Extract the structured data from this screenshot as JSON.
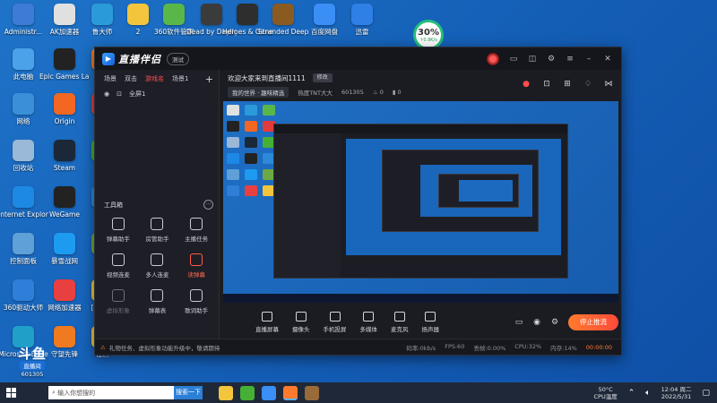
{
  "desktop": {
    "icons": [
      {
        "label": "Administr...",
        "color": "#3d7bd6"
      },
      {
        "label": "AK加速器",
        "color": "#e0e0e0"
      },
      {
        "label": "鲁大师",
        "color": "#2a9bd8"
      },
      {
        "label": "2",
        "color": "#f2c53d"
      },
      {
        "label": "360软件管家",
        "color": "#59b74a"
      },
      {
        "label": "Dead by Daylight",
        "color": "#3b3b3b"
      },
      {
        "label": "Heroes & Generals",
        "color": "#2e2e2e"
      },
      {
        "label": "Stranded Deep",
        "color": "#8a5a20"
      },
      {
        "label": "百度网盘",
        "color": "#3a8ef6"
      },
      {
        "label": "迅雷",
        "color": "#2e7fe6"
      },
      {
        "label": "此电脑",
        "color": "#4aa3e8"
      },
      {
        "label": "Epic Games Launcher",
        "color": "#222222"
      },
      {
        "label": "守望",
        "color": "#f07a20"
      },
      {
        "label": "网络",
        "color": "#3a8fd8"
      },
      {
        "label": "Origin",
        "color": "#f26722"
      },
      {
        "label": "腾讯",
        "color": "#e23b3b"
      },
      {
        "label": "回收站",
        "color": "#9ab8d8"
      },
      {
        "label": "Steam",
        "color": "#1b2838"
      },
      {
        "label": "微",
        "color": "#45b035"
      },
      {
        "label": "Internet Explorer",
        "color": "#1e88e5"
      },
      {
        "label": "WeGame",
        "color": "#222222"
      },
      {
        "label": "腾",
        "color": "#2c8ad8"
      },
      {
        "label": "控制面板",
        "color": "#5fa0d8"
      },
      {
        "label": "暴雪战网",
        "color": "#1d9bf0"
      },
      {
        "label": "我的",
        "color": "#6ca845"
      },
      {
        "label": "360驱动大师",
        "color": "#2f7fd8"
      },
      {
        "label": "网络加速器",
        "color": "#e84040"
      },
      {
        "label": "[2021-",
        "color": "#f2c53d"
      },
      {
        "label": "Microsoft Edge",
        "color": "#1fa0c8"
      },
      {
        "label": "守望先锋",
        "color": "#f07a20"
      },
      {
        "label": "社区",
        "color": "#f2c53d"
      }
    ],
    "net_widget": {
      "percent": "30%",
      "speed": "↑0.9K/s"
    }
  },
  "app": {
    "logo_text": "直播伴侣",
    "version_badge": "测试",
    "scene_tabs": [
      "场景",
      "双击",
      "游戏名",
      "场景1"
    ],
    "scene_active_index": 2,
    "source_item": "全屏1",
    "tools_title": "工具箱",
    "tools": [
      {
        "label": "弹幕助手",
        "icon": "chat-icon"
      },
      {
        "label": "房管助手",
        "icon": "user-icon"
      },
      {
        "label": "主播任务",
        "icon": "task-icon"
      },
      {
        "label": "视频连麦",
        "icon": "video-icon"
      },
      {
        "label": "多人连麦",
        "icon": "people-icon"
      },
      {
        "label": "读弹幕",
        "icon": "read-icon"
      },
      {
        "label": "虚拟形象",
        "icon": "avatar-icon"
      },
      {
        "label": "弹幕表",
        "icon": "list-icon"
      },
      {
        "label": "歌词助手",
        "icon": "lyric-icon"
      }
    ],
    "room_title": "欢迎大家来到直播间1111",
    "edit_label": "修改",
    "room_meta": {
      "tag1": "我的世界",
      "tag2": "趣味精选",
      "hot": "热度TNT大大",
      "room_id": "601305",
      "likes": "0",
      "viewers": "0"
    },
    "controls": [
      {
        "label": "直播屏幕"
      },
      {
        "label": "摄像头"
      },
      {
        "label": "手机投屏"
      },
      {
        "label": "多媒体"
      },
      {
        "label": "麦克风"
      },
      {
        "label": "扬声器"
      }
    ],
    "go_live_label": "停止推流",
    "status": {
      "message": "礼物任务、虚拟形象功能升级中，敬请期待",
      "bitrate": "码率:0kb/s",
      "fps": "FPS:60",
      "drop": "丢帧:0.00%",
      "cpu": "CPU:32%",
      "mem": "内存:14%",
      "timer": "00:00:00"
    }
  },
  "watermark": {
    "logo": "斗鱼",
    "tag": "直播间",
    "id": "601305"
  },
  "taskbar": {
    "search_placeholder": "输入你想搜的",
    "search_button": "搜索一下",
    "apps": [
      {
        "color": "#f2c53d"
      },
      {
        "color": "#45b035"
      },
      {
        "color": "#3a8ef6"
      },
      {
        "color": "#ff7a2e"
      },
      {
        "color": "#9a6b3a"
      }
    ],
    "temp": "50°C",
    "temp_label": "CPU温度",
    "time": "12:04 周二",
    "date": "2022/5/31"
  },
  "colors": {
    "accent": "#ff4d4d",
    "desktop_bg": "#1560b8",
    "app_bg": "#1b1c22"
  }
}
